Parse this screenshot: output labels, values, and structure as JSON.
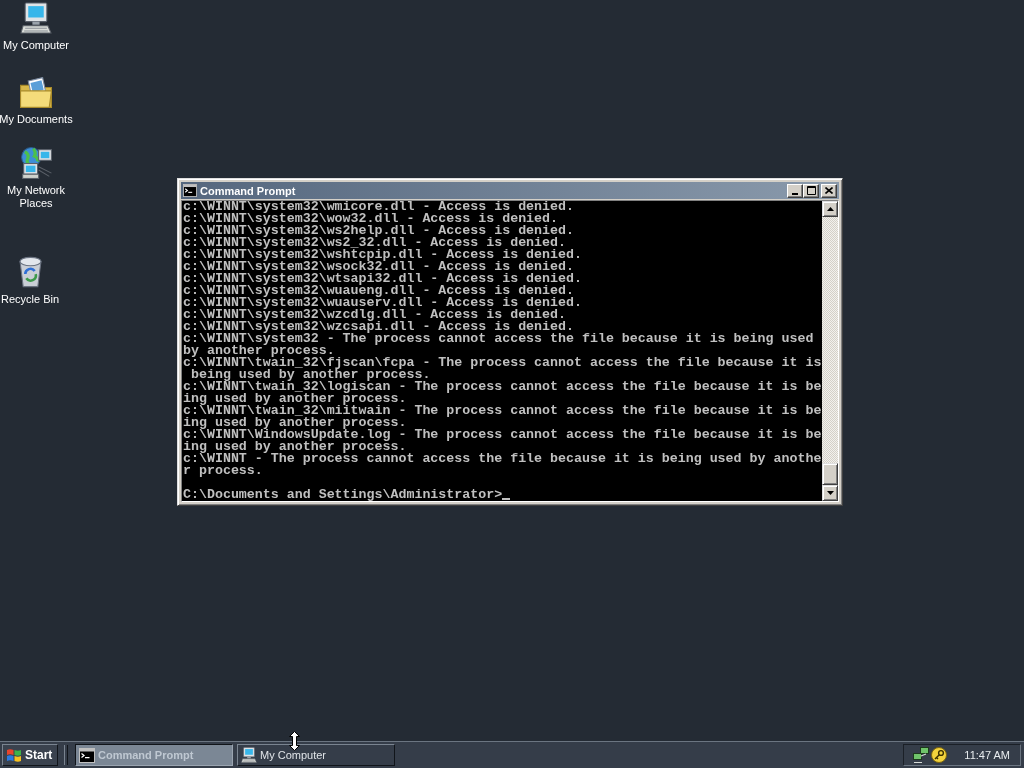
{
  "desktop": {
    "icons": [
      {
        "label": "My Computer",
        "kind": "computer"
      },
      {
        "label": "My Documents",
        "kind": "documents"
      },
      {
        "label": "My Network Places",
        "kind": "network"
      },
      {
        "label": "Recycle Bin",
        "kind": "recycle_bin"
      }
    ]
  },
  "window": {
    "title": "Command Prompt",
    "console": {
      "lines": [
        "c:\\WINNT\\system32\\wmicore.dll - Access is denied.",
        "c:\\WINNT\\system32\\wow32.dll - Access is denied.",
        "c:\\WINNT\\system32\\ws2help.dll - Access is denied.",
        "c:\\WINNT\\system32\\ws2_32.dll - Access is denied.",
        "c:\\WINNT\\system32\\wshtcpip.dll - Access is denied.",
        "c:\\WINNT\\system32\\wsock32.dll - Access is denied.",
        "c:\\WINNT\\system32\\wtsapi32.dll - Access is denied.",
        "c:\\WINNT\\system32\\wuaueng.dll - Access is denied.",
        "c:\\WINNT\\system32\\wuauserv.dll - Access is denied.",
        "c:\\WINNT\\system32\\wzcdlg.dll - Access is denied.",
        "c:\\WINNT\\system32\\wzcsapi.dll - Access is denied.",
        "c:\\WINNT\\system32 - The process cannot access the file because it is being used",
        "by another process.",
        "c:\\WINNT\\twain_32\\fjscan\\fcpa - The process cannot access the file because it is",
        " being used by another process.",
        "c:\\WINNT\\twain_32\\logiscan - The process cannot access the file because it is be",
        "ing used by another process.",
        "c:\\WINNT\\twain_32\\miitwain - The process cannot access the file because it is be",
        "ing used by another process.",
        "c:\\WINNT\\WindowsUpdate.log - The process cannot access the file because it is be",
        "ing used by another process.",
        "c:\\WINNT - The process cannot access the file because it is being used by anothe",
        "r process."
      ],
      "prompt": "C:\\Documents and Settings\\Administrator>"
    }
  },
  "taskbar": {
    "start": "Start",
    "tasks": [
      {
        "label": "Command Prompt",
        "kind": "console",
        "selected": true
      },
      {
        "label": "My Computer",
        "kind": "computer",
        "selected": false
      }
    ],
    "clock": "11:47 AM"
  }
}
